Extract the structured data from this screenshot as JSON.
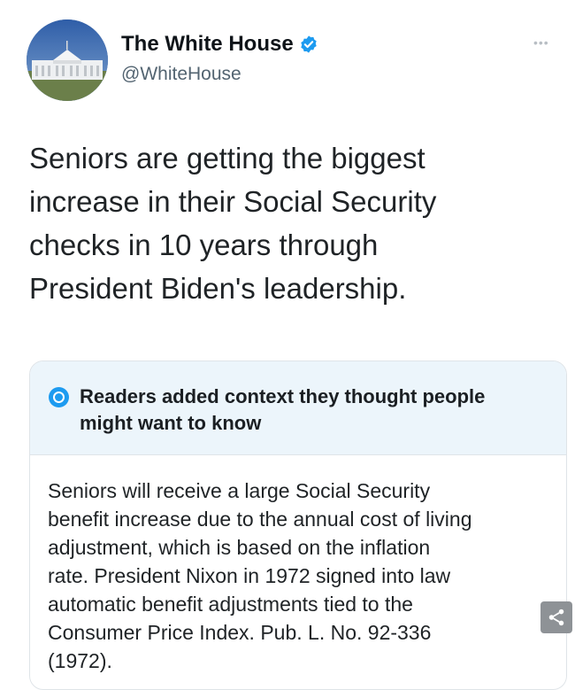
{
  "account": {
    "display_name": "The White House",
    "handle": "@WhiteHouse",
    "verified_icon": "verified-badge-icon",
    "more_icon": "more-options-icon"
  },
  "tweet": {
    "lines": [
      "Seniors are getting the biggest",
      "increase in their Social Security",
      "checks in 10 years through",
      "President Biden's leadership."
    ]
  },
  "community_note": {
    "icon": "community-notes-icon",
    "title_lines": [
      "Readers added context they thought people",
      "might want to know"
    ],
    "body_lines": [
      "Seniors will receive a large Social Security",
      "benefit increase due to the annual cost of living",
      "adjustment, which is based on the inflation",
      "rate. President Nixon in 1972 signed into law",
      "automatic benefit adjustments tied to the",
      "Consumer Price Index. Pub. L. No. 92-336",
      "(1972)."
    ]
  },
  "share_icon": "share-icon",
  "colors": {
    "accent": "#1d9bf0",
    "note_header_bg": "#ecf5fb",
    "secondary_text": "#536471"
  }
}
